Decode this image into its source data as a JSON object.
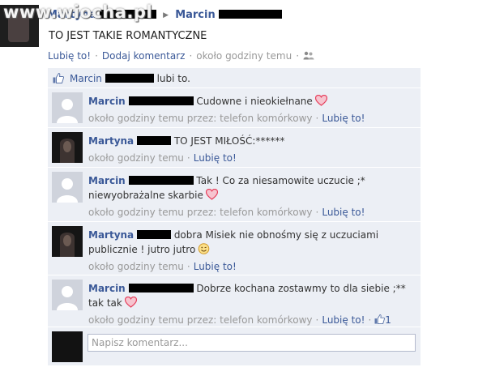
{
  "watermark": "www.wiocha.pl",
  "post": {
    "author": "Martyna",
    "recipient": "Marcin",
    "text": "TO JEST TAKIE ROMANTYCZNE",
    "actions": {
      "like": "Lubię to!",
      "comment": "Dodaj komentarz",
      "time": "około godziny temu",
      "separator": "·"
    }
  },
  "likes": {
    "name": "Marcin",
    "suffix": "lubi to."
  },
  "comments": [
    {
      "author": "Marcin",
      "text": "Cudowne i nieokiełnane",
      "heart": true,
      "time": "około godziny temu",
      "via": "przez: telefon komórkowy",
      "like": "Lubię to!"
    },
    {
      "author": "Martyna",
      "text": "TO JEST MIŁOŚĆ:******",
      "time": "około godziny temu",
      "like": "Lubię to!"
    },
    {
      "author": "Marcin",
      "text": "Tak ! Co za niesamowite uczucie ;* niewyobrażalne skarbie",
      "heart": true,
      "time": "około godziny temu",
      "via": "przez: telefon komórkowy",
      "like": "Lubię to!"
    },
    {
      "author": "Martyna",
      "text": "dobra Misiek nie obnośmy się z uczuciami publicznie ! jutro jutro",
      "smiley": true,
      "time": "około godziny temu",
      "like": "Lubię to!"
    },
    {
      "author": "Marcin",
      "text": "Dobrze kochana zostawmy to dla siebie ;** tak tak",
      "heart": true,
      "time": "około godziny temu",
      "via": "przez: telefon komórkowy",
      "like": "Lubię to!",
      "like_count": "1"
    }
  ],
  "composer": {
    "placeholder": "Napisz komentarz..."
  },
  "colors": {
    "link": "#3b5998",
    "meta": "#999999",
    "feedback_bg": "#eceff5",
    "heart": "#e63f5c"
  },
  "icons": [
    "thumbs-up-icon",
    "people-icon",
    "heart-icon",
    "smiley-icon",
    "arrow-right-icon"
  ]
}
